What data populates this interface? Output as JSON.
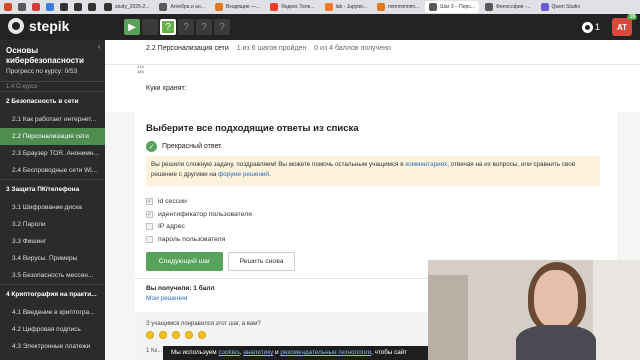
{
  "browser_tabs": [
    {
      "icon": "ai-icon",
      "label": "",
      "color": "#d24c2c"
    },
    {
      "icon": "stepik-icon",
      "label": "",
      "color": "#58595b"
    },
    {
      "icon": "h-icon",
      "label": "",
      "color": "#d73a3a"
    },
    {
      "icon": "image-icon",
      "label": "",
      "color": "#3b7de0"
    },
    {
      "icon": "github-icon",
      "label": "",
      "color": "#333333"
    },
    {
      "icon": "github-icon",
      "label": "",
      "color": "#333333"
    },
    {
      "icon": "github-icon",
      "label": "",
      "color": "#333333"
    },
    {
      "icon": "github-icon",
      "label": "study_2025-2...",
      "color": "#333333"
    },
    {
      "icon": "stepik-icon",
      "label": "Алгебра и ан...",
      "color": "#58595b"
    },
    {
      "icon": "mail-icon",
      "label": "Входящие —...",
      "color": "#e07b22"
    },
    {
      "icon": "yandex-icon",
      "label": "Яндекс Теле...",
      "color": "#f23b2b"
    },
    {
      "icon": "jupyter-icon",
      "label": "lab - Jupyter...",
      "color": "#f37726"
    },
    {
      "icon": "mail-icon",
      "label": "пппппппппп...",
      "color": "#e07b22"
    },
    {
      "icon": "stepik-icon",
      "label": "Шаг 3 – Перс...",
      "color": "#58595b"
    },
    {
      "icon": "stepik-icon",
      "label": "Философия -...",
      "color": "#58595b"
    },
    {
      "icon": "qwen-icon",
      "label": "Qwen Studio",
      "color": "#6b5bd6"
    }
  ],
  "topbar": {
    "logo_text": "stepik",
    "steps": [
      {
        "icon": "play-icon",
        "glyph": "▶",
        "state": "done"
      },
      {
        "icon": "text-icon",
        "glyph": "",
        "state": "plain"
      },
      {
        "icon": "quiz-icon",
        "glyph": "?",
        "state": "cur"
      },
      {
        "icon": "quiz-icon",
        "glyph": "?",
        "state": "q"
      },
      {
        "icon": "quiz-icon",
        "glyph": "?",
        "state": "q"
      },
      {
        "icon": "quiz-icon",
        "glyph": "?",
        "state": "q"
      }
    ],
    "notifications": "1",
    "avatar_initials": "AT",
    "avatar_badge": "19",
    "accent": "#66b34b"
  },
  "sidebar": {
    "course_title": "Основы кибербезопасности",
    "progress": "Прогресс по курсу:  0/53",
    "cut_item": "1.4  О курсе",
    "modules": [
      {
        "title": "2  Безопасность в сети",
        "items": [
          "2.1  Как работает интернет...",
          "2.2  Персонализация сети",
          "2.3  Браузер TOR. Анонимн...",
          "2.4  Беспроводные сети Wi..."
        ],
        "active_index": 1
      },
      {
        "title": "3  Защита ПК/телефона",
        "items": [
          "3.1  Шифрование диска",
          "3.2  Пароли",
          "3.3  Фишинг",
          "3.4  Вирусы. Примеры",
          "3.5  Безопасность мессен..."
        ],
        "active_index": -1
      },
      {
        "title": "4  Криптография на практи...",
        "items": [
          "4.1  Введение в криптогра...",
          "4.2  Цифровая подпись",
          "4.3  Электронные платежи"
        ],
        "active_index": -1
      }
    ]
  },
  "main": {
    "step_title": "2.2 Персонализация сети",
    "passed": "1 из 6 шагов пройден",
    "score": "0 из 4 баллов  получено",
    "cursor_label_top": "214",
    "cursor_label_bottom": "186",
    "question": "Куки хранят:",
    "choose_title": "Выберите все подходящие ответы из списка",
    "ok_text": "Прекрасный ответ.",
    "notice_pre": "Вы решили сложную задачу, поздравляем! Вы можете помочь остальным учащимся в ",
    "notice_link1": "комментариях",
    "notice_mid": ", отвечая на их вопросы, или сравнить своё решение с другими на ",
    "notice_link2": "форуме решений",
    "notice_end": ".",
    "options": [
      {
        "label": "id сессии",
        "checked": true
      },
      {
        "label": "идентификатор пользователя",
        "checked": true
      },
      {
        "label": "IP адрес",
        "checked": false
      },
      {
        "label": "пароль пользователя",
        "checked": false
      }
    ],
    "next_button": "Следующий шаг",
    "retry_button": "Решить снова",
    "got_points": "Вы получили: 1 балл",
    "my_solutions": "Мои решения",
    "feedback_question": "З учащимся понравился этот шаг, а вам?",
    "ticker": "1 Кк..."
  },
  "cookie_bar": {
    "pre": "Мы используем ",
    "link1": "cookies",
    "comma": ", ",
    "link2": "аналитику",
    "and": " и ",
    "link3": "рекомендательные технологии",
    "post": ", чтобы сайт"
  }
}
